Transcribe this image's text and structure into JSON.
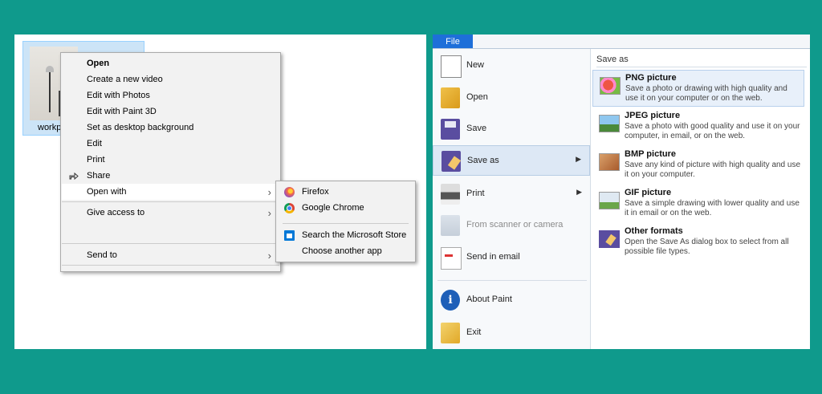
{
  "explorer": {
    "file_label": "workp",
    "context_menu": {
      "items": [
        {
          "label": "Open",
          "bold": true
        },
        {
          "label": "Create a new video"
        },
        {
          "label": "Edit with Photos"
        },
        {
          "label": "Edit with Paint 3D"
        },
        {
          "label": "Set as desktop background"
        },
        {
          "label": "Edit"
        },
        {
          "label": "Print"
        },
        {
          "label": "Share",
          "icon": "share-icon"
        },
        {
          "label": "Open with",
          "submenu": true,
          "highlighted": true
        },
        {
          "label": "Give access to",
          "submenu": true
        },
        {
          "label": "Send to",
          "submenu": true
        }
      ]
    },
    "open_with_submenu": {
      "items": [
        {
          "label": "Firefox",
          "icon": "firefox-icon"
        },
        {
          "label": "Google Chrome",
          "icon": "chrome-icon"
        },
        {
          "label": "Search the Microsoft Store",
          "icon": "microsoft-store-icon"
        },
        {
          "label": "Choose another app"
        }
      ]
    }
  },
  "paint": {
    "file_tab": "File",
    "menu": [
      {
        "label": "New",
        "icon": "new-file-icon"
      },
      {
        "label": "Open",
        "icon": "open-folder-icon"
      },
      {
        "label": "Save",
        "icon": "save-icon"
      },
      {
        "label": "Save as",
        "icon": "save-as-icon",
        "active": true,
        "submenu": true
      },
      {
        "label": "Print",
        "icon": "printer-icon",
        "submenu": true
      },
      {
        "label": "From scanner or camera",
        "icon": "scanner-icon",
        "disabled": true
      },
      {
        "label": "Send in email",
        "icon": "email-icon"
      },
      {
        "label": "About Paint",
        "icon": "info-icon"
      },
      {
        "label": "Exit",
        "icon": "exit-icon"
      }
    ],
    "save_as": {
      "header": "Save as",
      "formats": [
        {
          "title": "PNG picture",
          "desc": "Save a photo or drawing with high quality and use it on your computer or on the web.",
          "icon": "png-picture-icon",
          "highlighted": true
        },
        {
          "title": "JPEG picture",
          "desc": "Save a photo with good quality and use it on your computer, in email, or on the web.",
          "icon": "jpeg-picture-icon"
        },
        {
          "title": "BMP picture",
          "desc": "Save any kind of picture with high quality and use it on your computer.",
          "icon": "bmp-picture-icon"
        },
        {
          "title": "GIF picture",
          "desc": "Save a simple drawing with lower quality and use it in email or on the web.",
          "icon": "gif-picture-icon"
        },
        {
          "title": "Other formats",
          "desc": "Open the Save As dialog box to select from all possible file types.",
          "icon": "other-formats-icon"
        }
      ]
    }
  },
  "colors": {
    "background": "#0f9a8c",
    "paint_file_tab": "#1e6fd9"
  }
}
